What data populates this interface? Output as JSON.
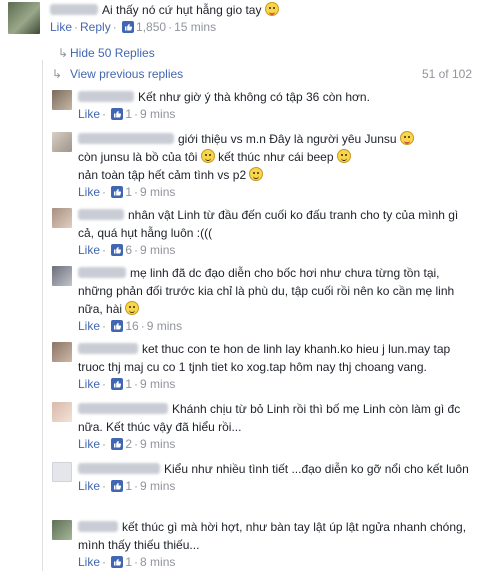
{
  "top_comment": {
    "text": "Ai thấy nó cứ hụt hẫng gio tay",
    "like_label": "Like",
    "reply_label": "Reply",
    "like_count": "1,850",
    "time": "15 mins"
  },
  "thread": {
    "hide_label": "Hide 50 Replies",
    "view_previous_label": "View previous replies",
    "count_label": "51 of 102"
  },
  "replies": [
    {
      "text": "Kết như giờ ý thà không có tập 36 còn hơn.",
      "likes": "1",
      "time": "9 mins"
    },
    {
      "text_parts": [
        "giới thiệu vs m.n Đây là người yêu Junsu ",
        " còn junsu là bồ của tôi ",
        " kết thúc như cái beep ",
        " nản toàn tập hết cảm tình vs p2 "
      ],
      "likes": "1",
      "time": "9 mins"
    },
    {
      "text": "nhân vật Linh từ đầu đến cuối ko đấu tranh cho ty của mình gì cả, quá hụt hẫng luôn :(((",
      "likes": "6",
      "time": "9 mins"
    },
    {
      "text": "mẹ linh đã dc đạo diễn cho bốc hơi như chưa từng tồn tại, những phản đối trước kia chỉ là phù du, tập cuối rồi nên ko cần mẹ linh nữa, hài ",
      "likes": "16",
      "time": "9 mins"
    },
    {
      "text": "ket thuc con te hon de linh lay khanh.ko hieu j lun.may tap truoc thj maj cu co 1 tjnh tiet ko xog.tap hôm nay thj choang vang.",
      "likes": "1",
      "time": "9 mins"
    },
    {
      "text": "Khánh chịu từ bỏ Linh rồi thì bố mẹ Linh còn làm gì đc nữa. Kết thúc vậy đã hiểu rồi...",
      "likes": "2",
      "time": "9 mins"
    },
    {
      "text": "Kiểu như nhiều tình tiết ...đạo diễn ko gỡ nổi cho kết luôn",
      "likes": "1",
      "time": "9 mins"
    },
    {
      "text": "kết thúc gì mà hời hợt, như bàn tay lật úp lật ngửa nhanh chóng, mình thấy thiếu thiếu...",
      "likes": "1",
      "time": "8 mins"
    }
  ],
  "labels": {
    "like": "Like"
  },
  "colors": {
    "link": "#4267b2",
    "meta": "#90949c",
    "border": "#dddfe2"
  },
  "icons": {
    "like": "thumbs-up-icon",
    "emoji_smile": "smile-emoji-icon",
    "emoji_tongue": "tongue-emoji-icon",
    "arrow": "reply-arrow-icon"
  }
}
